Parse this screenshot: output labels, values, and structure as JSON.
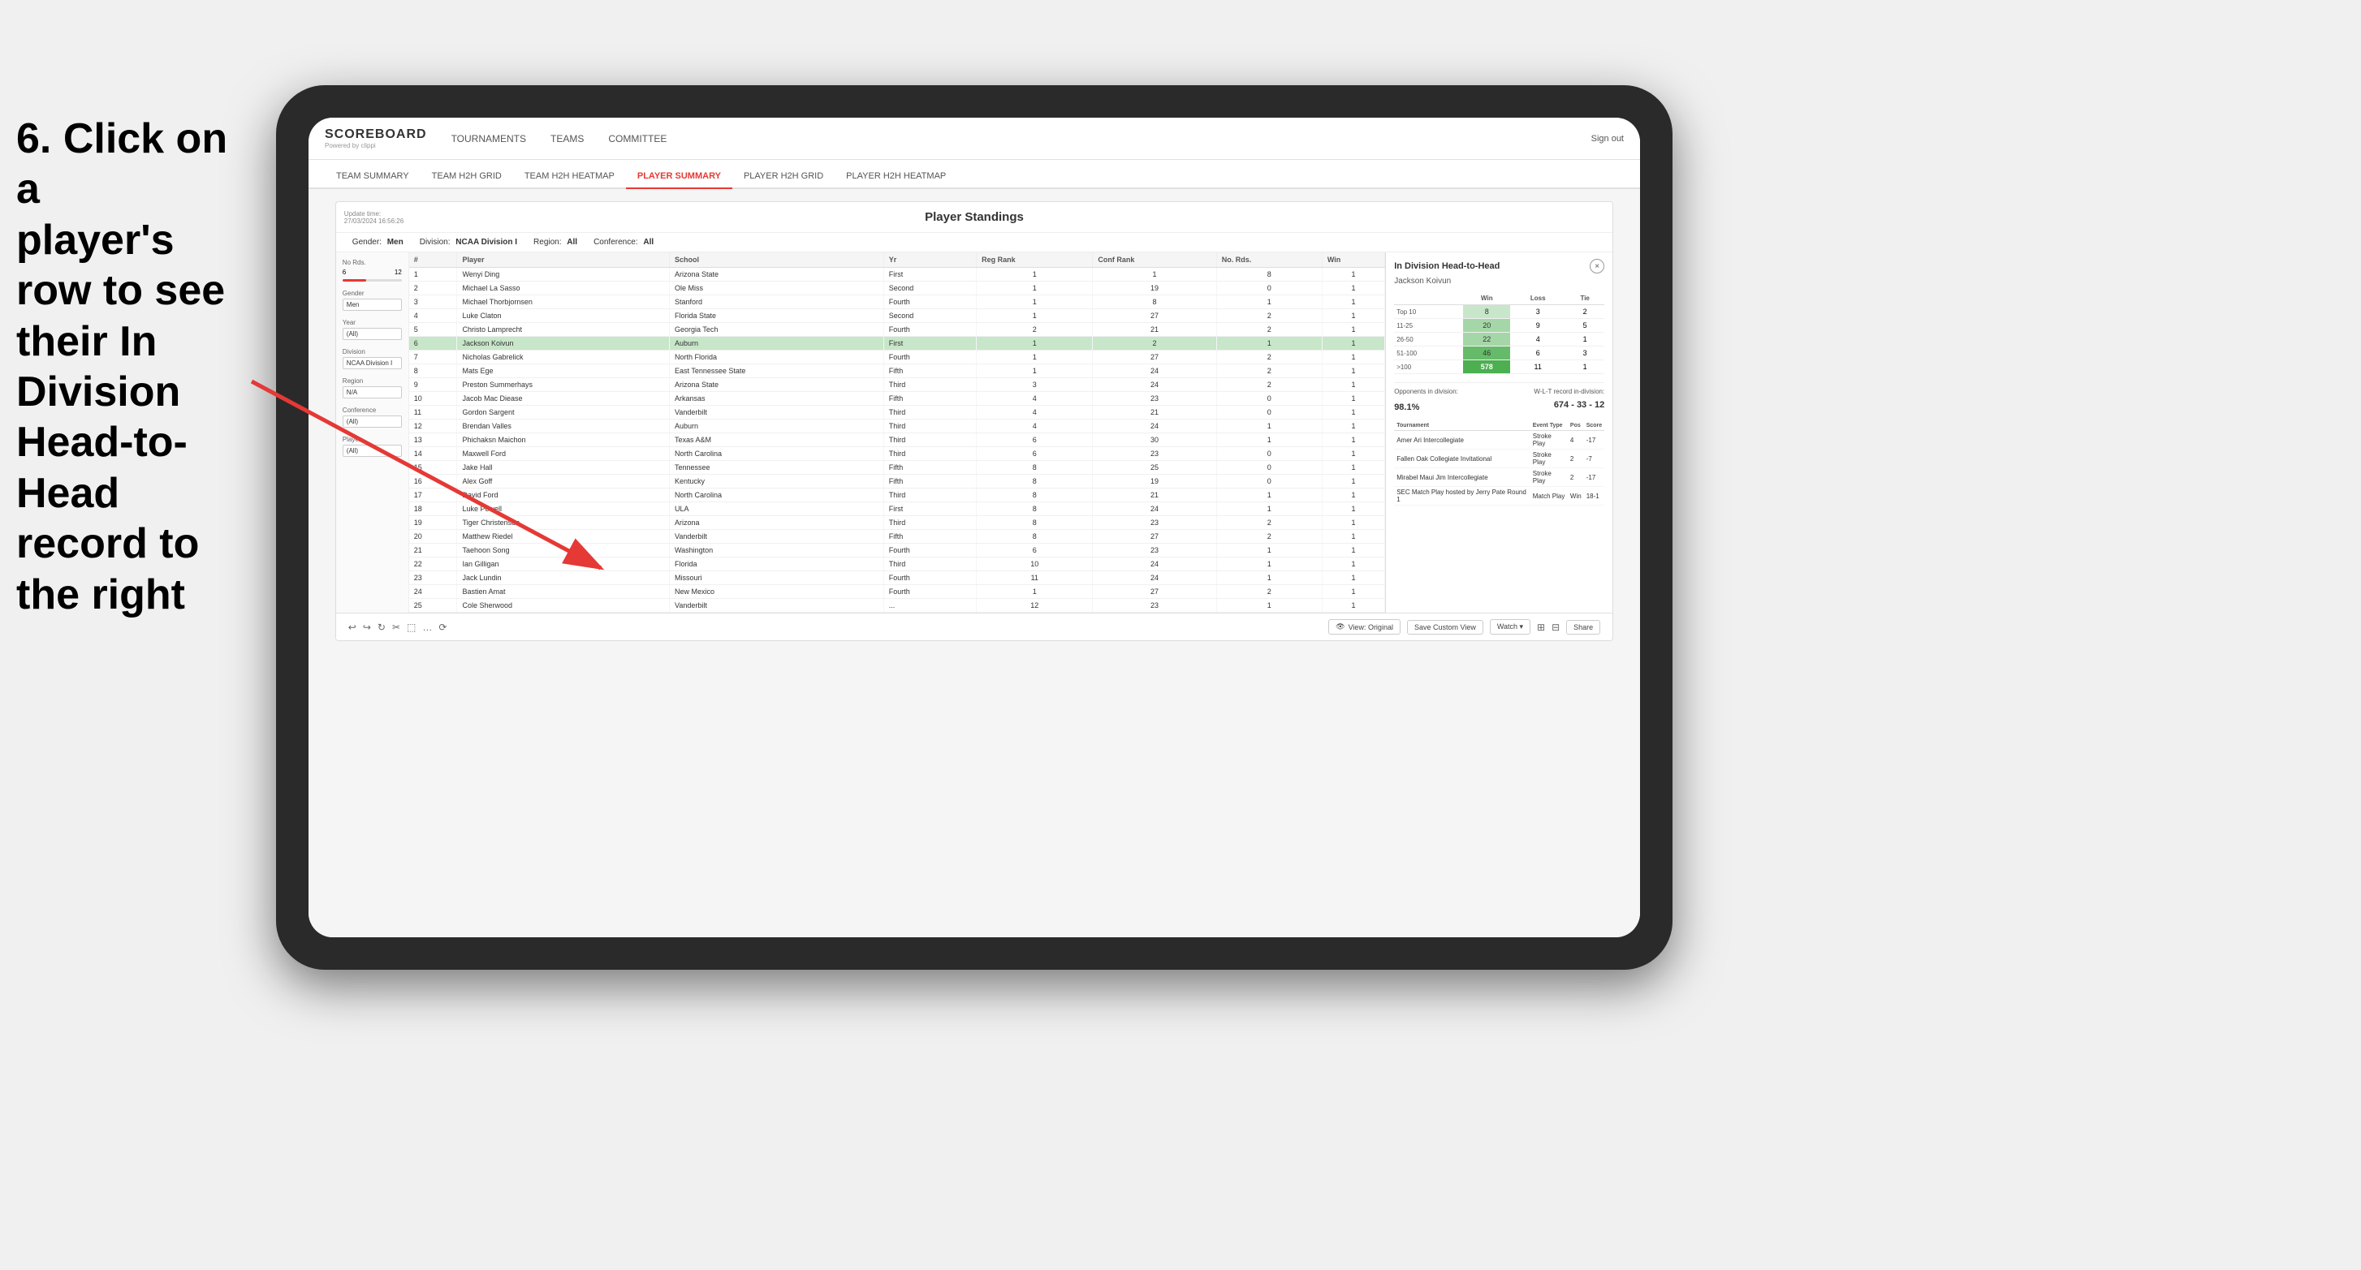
{
  "instruction": {
    "line1": "6. Click on a",
    "line2": "player's row to see",
    "line3": "their In Division",
    "line4": "Head-to-Head",
    "line5": "record to the right"
  },
  "nav": {
    "logo": "SCOREBOARD",
    "logo_sub": "Powered by clippi",
    "links": [
      "TOURNAMENTS",
      "TEAMS",
      "COMMITTEE"
    ],
    "sign_out": "Sign out"
  },
  "sub_nav": {
    "items": [
      "TEAM SUMMARY",
      "TEAM H2H GRID",
      "TEAM H2H HEATMAP",
      "PLAYER SUMMARY",
      "PLAYER H2H GRID",
      "PLAYER H2H HEATMAP"
    ],
    "active": "PLAYER SUMMARY"
  },
  "panel": {
    "update_time": "Update time:",
    "update_date": "27/03/2024 16:56:26",
    "title": "Player Standings",
    "filter_gender_label": "Gender:",
    "filter_gender_val": "Men",
    "filter_division_label": "Division:",
    "filter_division_val": "NCAA Division I",
    "filter_region_label": "Region:",
    "filter_region_val": "All",
    "filter_conference_label": "Conference:",
    "filter_conference_val": "All"
  },
  "sidebar": {
    "no_rds_label": "No Rds.",
    "no_rds_min": "6",
    "no_rds_max": "12",
    "gender_label": "Gender",
    "gender_val": "Men",
    "year_label": "Year",
    "year_val": "(All)",
    "division_label": "Division",
    "division_val": "NCAA Division I",
    "region_label": "Region",
    "region_val": "N/A",
    "conference_label": "Conference",
    "conference_val": "(All)",
    "player_label": "Player",
    "player_val": "(All)"
  },
  "table": {
    "columns": [
      "#",
      "Player",
      "School",
      "Yr",
      "Reg Rank",
      "Conf Rank",
      "No. Rds.",
      "Win"
    ],
    "rows": [
      {
        "num": "1",
        "player": "Wenyi Ding",
        "school": "Arizona State",
        "yr": "First",
        "reg": "1",
        "conf": "1",
        "rds": "8",
        "win": "1",
        "selected": false
      },
      {
        "num": "2",
        "player": "Michael La Sasso",
        "school": "Ole Miss",
        "yr": "Second",
        "reg": "1",
        "conf": "19",
        "rds": "0",
        "win": "1",
        "selected": false
      },
      {
        "num": "3",
        "player": "Michael Thorbjornsen",
        "school": "Stanford",
        "yr": "Fourth",
        "reg": "1",
        "conf": "8",
        "rds": "1",
        "win": "1",
        "selected": false
      },
      {
        "num": "4",
        "player": "Luke Claton",
        "school": "Florida State",
        "yr": "Second",
        "reg": "1",
        "conf": "27",
        "rds": "2",
        "win": "1",
        "selected": false
      },
      {
        "num": "5",
        "player": "Christo Lamprecht",
        "school": "Georgia Tech",
        "yr": "Fourth",
        "reg": "2",
        "conf": "21",
        "rds": "2",
        "win": "1",
        "selected": false
      },
      {
        "num": "6",
        "player": "Jackson Koivun",
        "school": "Auburn",
        "yr": "First",
        "reg": "1",
        "conf": "2",
        "rds": "1",
        "win": "1",
        "selected": true
      },
      {
        "num": "7",
        "player": "Nicholas Gabrelick",
        "school": "North Florida",
        "yr": "Fourth",
        "reg": "1",
        "conf": "27",
        "rds": "2",
        "win": "1",
        "selected": false
      },
      {
        "num": "8",
        "player": "Mats Ege",
        "school": "East Tennessee State",
        "yr": "Fifth",
        "reg": "1",
        "conf": "24",
        "rds": "2",
        "win": "1",
        "selected": false
      },
      {
        "num": "9",
        "player": "Preston Summerhays",
        "school": "Arizona State",
        "yr": "Third",
        "reg": "3",
        "conf": "24",
        "rds": "2",
        "win": "1",
        "selected": false
      },
      {
        "num": "10",
        "player": "Jacob Mac Diease",
        "school": "Arkansas",
        "yr": "Fifth",
        "reg": "4",
        "conf": "23",
        "rds": "0",
        "win": "1",
        "selected": false
      },
      {
        "num": "11",
        "player": "Gordon Sargent",
        "school": "Vanderbilt",
        "yr": "Third",
        "reg": "4",
        "conf": "21",
        "rds": "0",
        "win": "1",
        "selected": false
      },
      {
        "num": "12",
        "player": "Brendan Valles",
        "school": "Auburn",
        "yr": "Third",
        "reg": "4",
        "conf": "24",
        "rds": "1",
        "win": "1",
        "selected": false
      },
      {
        "num": "13",
        "player": "Phichaksn Maichon",
        "school": "Texas A&M",
        "yr": "Third",
        "reg": "6",
        "conf": "30",
        "rds": "1",
        "win": "1",
        "selected": false
      },
      {
        "num": "14",
        "player": "Maxwell Ford",
        "school": "North Carolina",
        "yr": "Third",
        "reg": "6",
        "conf": "23",
        "rds": "0",
        "win": "1",
        "selected": false
      },
      {
        "num": "15",
        "player": "Jake Hall",
        "school": "Tennessee",
        "yr": "Fifth",
        "reg": "8",
        "conf": "25",
        "rds": "0",
        "win": "1",
        "selected": false
      },
      {
        "num": "16",
        "player": "Alex Goff",
        "school": "Kentucky",
        "yr": "Fifth",
        "reg": "8",
        "conf": "19",
        "rds": "0",
        "win": "1",
        "selected": false
      },
      {
        "num": "17",
        "player": "David Ford",
        "school": "North Carolina",
        "yr": "Third",
        "reg": "8",
        "conf": "21",
        "rds": "1",
        "win": "1",
        "selected": false
      },
      {
        "num": "18",
        "player": "Luke Powell",
        "school": "ULA",
        "yr": "First",
        "reg": "8",
        "conf": "24",
        "rds": "1",
        "win": "1",
        "selected": false
      },
      {
        "num": "19",
        "player": "Tiger Christensen",
        "school": "Arizona",
        "yr": "Third",
        "reg": "8",
        "conf": "23",
        "rds": "2",
        "win": "1",
        "selected": false
      },
      {
        "num": "20",
        "player": "Matthew Riedel",
        "school": "Vanderbilt",
        "yr": "Fifth",
        "reg": "8",
        "conf": "27",
        "rds": "2",
        "win": "1",
        "selected": false
      },
      {
        "num": "21",
        "player": "Taehoon Song",
        "school": "Washington",
        "yr": "Fourth",
        "reg": "6",
        "conf": "23",
        "rds": "1",
        "win": "1",
        "selected": false
      },
      {
        "num": "22",
        "player": "Ian Gilligan",
        "school": "Florida",
        "yr": "Third",
        "reg": "10",
        "conf": "24",
        "rds": "1",
        "win": "1",
        "selected": false
      },
      {
        "num": "23",
        "player": "Jack Lundin",
        "school": "Missouri",
        "yr": "Fourth",
        "reg": "11",
        "conf": "24",
        "rds": "1",
        "win": "1",
        "selected": false
      },
      {
        "num": "24",
        "player": "Bastien Amat",
        "school": "New Mexico",
        "yr": "Fourth",
        "reg": "1",
        "conf": "27",
        "rds": "2",
        "win": "1",
        "selected": false
      },
      {
        "num": "25",
        "player": "Cole Sherwood",
        "school": "Vanderbilt",
        "yr": "...",
        "reg": "12",
        "conf": "23",
        "rds": "1",
        "win": "1",
        "selected": false
      }
    ]
  },
  "h2h": {
    "title": "In Division Head-to-Head",
    "player_name": "Jackson Koivun",
    "close_icon": "×",
    "table_headers": [
      "",
      "Win",
      "Loss",
      "Tie"
    ],
    "rows": [
      {
        "label": "Top 10",
        "win": "8",
        "loss": "3",
        "tie": "2",
        "win_shade": "light"
      },
      {
        "label": "11-25",
        "win": "20",
        "loss": "9",
        "tie": "5",
        "win_shade": "mid"
      },
      {
        "label": "26-50",
        "win": "22",
        "loss": "4",
        "tie": "1",
        "win_shade": "mid"
      },
      {
        "label": "51-100",
        "win": "46",
        "loss": "6",
        "tie": "3",
        "win_shade": "dark"
      },
      {
        "label": ">100",
        "win": "578",
        "loss": "11",
        "tie": "1",
        "win_shade": "bold"
      }
    ],
    "opponents_label": "Opponents in division:",
    "wlt_label": "W-L-T record in-division:",
    "pct": "98.1%",
    "record": "674 - 33 - 12",
    "tournament_headers": [
      "Tournament",
      "Event Type",
      "Pos",
      "Score"
    ],
    "tournaments": [
      {
        "name": "Amer Ari Intercollegiate",
        "type": "Stroke Play",
        "pos": "4",
        "score": "-17"
      },
      {
        "name": "Fallen Oak Collegiate Invitational",
        "type": "Stroke Play",
        "pos": "2",
        "score": "-7"
      },
      {
        "name": "Mirabel Maui Jim Intercollegiate",
        "type": "Stroke Play",
        "pos": "2",
        "score": "-17"
      },
      {
        "name": "SEC Match Play hosted by Jerry Pate Round 1",
        "type": "Match Play",
        "pos": "Win",
        "score": "18-1"
      }
    ]
  },
  "toolbar": {
    "undo": "↩",
    "redo": "↪",
    "view_original": "View: Original",
    "save_custom": "Save Custom View",
    "watch": "Watch ▾",
    "share": "Share"
  }
}
